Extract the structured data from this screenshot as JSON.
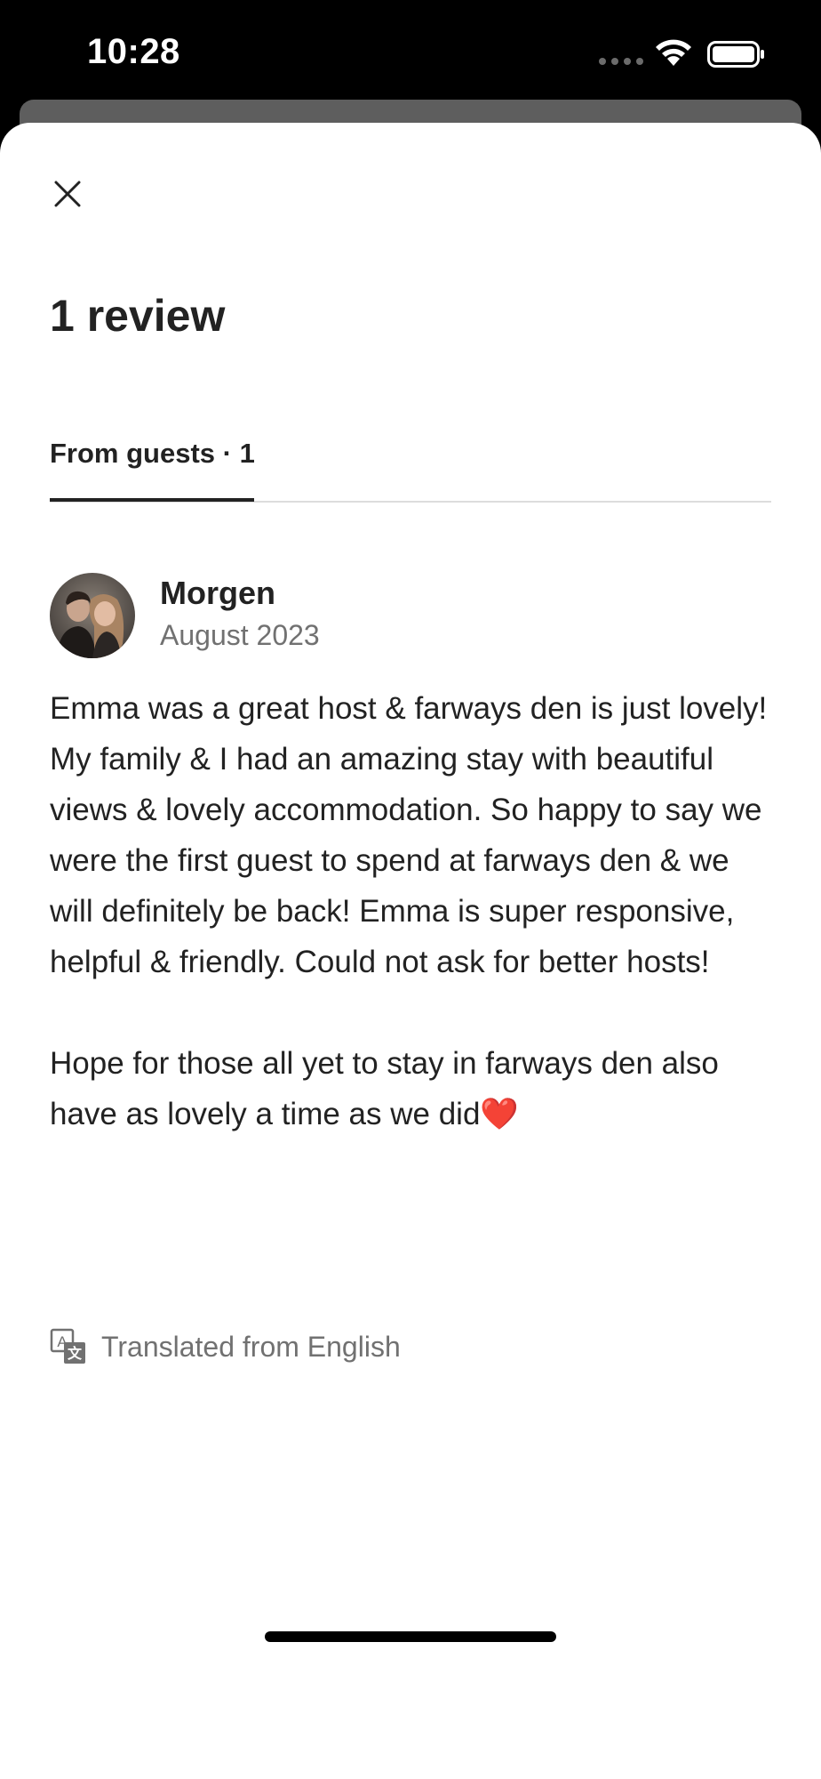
{
  "status_bar": {
    "time": "10:28"
  },
  "header": {
    "close_icon": "close-icon",
    "title": "1 review"
  },
  "tabs": [
    {
      "label": "From guests · 1",
      "selected": true
    }
  ],
  "review": {
    "reviewer_name": "Morgen",
    "date": "August 2023",
    "paragraphs": [
      "Emma was a great host & farways den is just lovely! My family & I had an amazing stay with beautiful views & lovely accommodation. So happy to say we were the first guest to spend at farways den & we will definitely be back! Emma is super responsive, helpful & friendly. Could not ask for better hosts!",
      "Hope for those all yet to stay in farways den also have as lovely a time as we did❤️"
    ],
    "translation_note": "Translated from English",
    "translation_icon": "translate-icon"
  },
  "colors": {
    "text_primary": "#222222",
    "text_secondary": "#717171",
    "divider": "#dddddd",
    "background": "#ffffff"
  }
}
